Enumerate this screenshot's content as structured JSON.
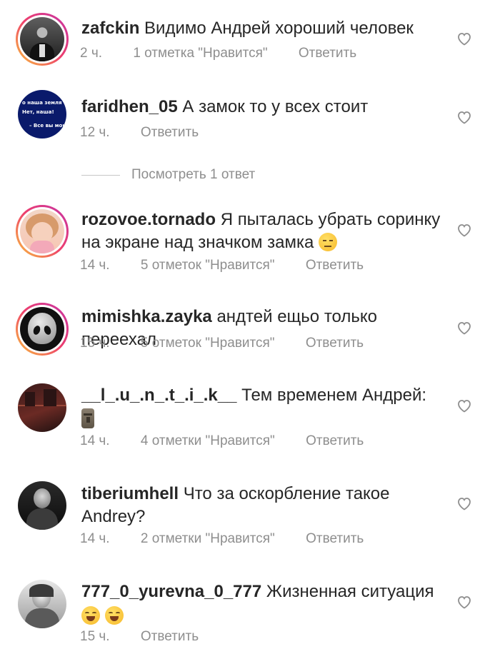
{
  "comments": [
    {
      "username": "zafckin",
      "text": "Видимо Андрей хороший человек",
      "time": "2 ч.",
      "likes": "1 отметка \"Нравится\"",
      "reply": "Ответить"
    },
    {
      "username": "faridhen_05",
      "text": "А замок то у всех стоит",
      "time": "12 ч.",
      "reply": "Ответить",
      "avatar_lines": [
        "о наша земля",
        "Нет, наша!",
        "– Все вы мои"
      ]
    },
    {
      "username": "rozovoe.tornado",
      "text": "Я пыталась убрать соринку на экране над значком замка",
      "time": "14 ч.",
      "likes": "5 отметок \"Нравится\"",
      "reply": "Ответить"
    },
    {
      "username": "mimishka.zayka",
      "text": "андтей ещьо только переехал",
      "time": "15 ч.",
      "likes": "5 отметок \"Нравится\"",
      "reply": "Ответить"
    },
    {
      "username": "__l_.u_.n_.t_.i_.k__",
      "text": "Тем временем Андрей:",
      "time": "14 ч.",
      "likes": "4 отметки \"Нравится\"",
      "reply": "Ответить"
    },
    {
      "username": "tiberiumhell",
      "text": "Что за оскорбление такое Andrey?",
      "time": "14 ч.",
      "likes": "2 отметки \"Нравится\"",
      "reply": "Ответить"
    },
    {
      "username": "777_0_yurevna_0_777",
      "text": "Жизненная ситуация",
      "time": "15 ч.",
      "reply": "Ответить"
    }
  ],
  "view_replies": "Посмотреть 1 ответ",
  "colors": {
    "text": "#262626",
    "meta": "#8e8e8e",
    "ring_start": "#f9c33b",
    "ring_end": "#c533a6"
  },
  "icons": {
    "like": "heart-outline-icon"
  }
}
